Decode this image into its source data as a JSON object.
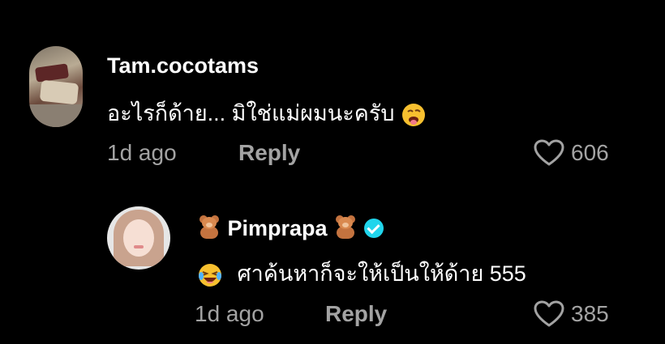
{
  "comment": {
    "username": "Tam.cocotams",
    "text": "อะไรก็ด้าย... มิใช่แม่ผมนะครับ",
    "emoji": "face-with-tongue-emoji",
    "time": "1d ago",
    "reply_label": "Reply",
    "likes": "606"
  },
  "reply": {
    "username": "Pimprapa",
    "text": "ศาค้นหาก็จะให้เป็นให้ด้าย 555",
    "emoji": "laughing-tears-emoji",
    "time": "1d ago",
    "reply_label": "Reply",
    "likes": "385",
    "verified_color": "#20d5ec"
  },
  "colors": {
    "background": "#000000",
    "primary_text": "#ffffff",
    "secondary_text": "#a3a3a3"
  }
}
